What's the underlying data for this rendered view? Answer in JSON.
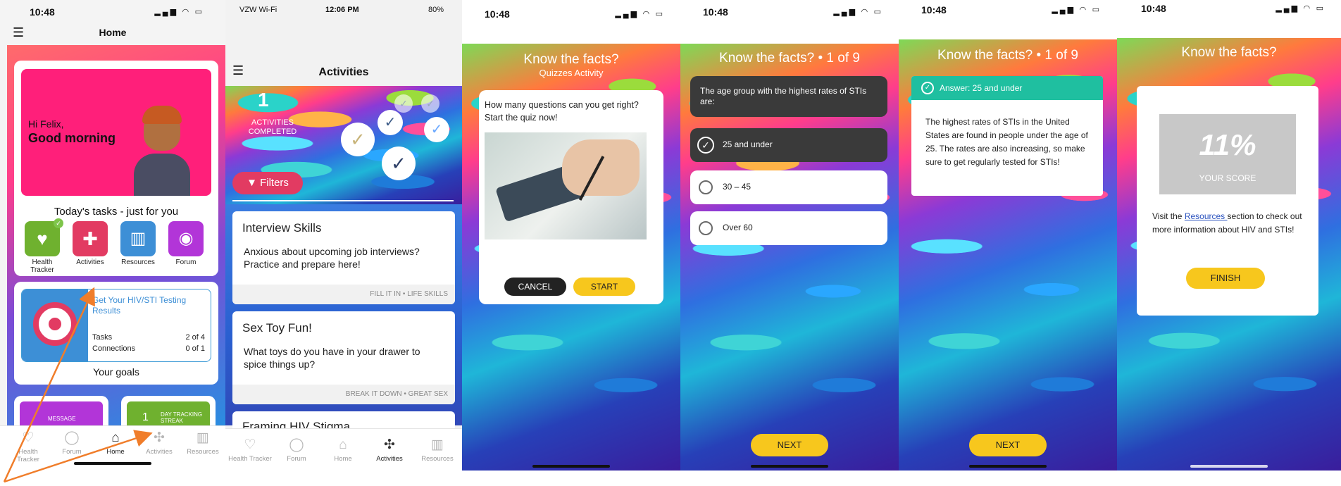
{
  "colors": {
    "accent_pink": "#ff1f7a",
    "accent_yellow": "#f7c71d",
    "accent_teal": "#1fbfa0",
    "link_blue": "#2a52be",
    "arrow_orange": "#f07d2a"
  },
  "screen1": {
    "time": "10:48",
    "title": "Home",
    "greeting_hi": "Hi Felix,",
    "greeting_main": "Good morning",
    "tasks_heading": "Today's tasks - just for you",
    "quick_actions": [
      {
        "label": "Health Tracker",
        "icon": "heart-pulse-icon",
        "color": "#6fb12f"
      },
      {
        "label": "Activities",
        "icon": "puzzle-icon",
        "color": "#e23b62"
      },
      {
        "label": "Resources",
        "icon": "books-icon",
        "color": "#3d8fd6"
      },
      {
        "label": "Forum",
        "icon": "chat-icon",
        "color": "#b235d8"
      }
    ],
    "goal": {
      "title": "Get Your HIV/STI Testing Results",
      "tasks_label": "Tasks",
      "tasks_value": "2 of 4",
      "connections_label": "Connections",
      "connections_value": "0 of 1"
    },
    "goals_heading": "Your goals",
    "tile_message": "MESSAGE",
    "tile_day_tracking": "DAY TRACKING STREAK",
    "tile_day_number": "1",
    "tabs": [
      "Health Tracker",
      "Forum",
      "Home",
      "Activities",
      "Resources"
    ]
  },
  "screen2": {
    "carrier": "VZW Wi-Fi",
    "time": "12:06 PM",
    "battery": "80%",
    "title": "Activities",
    "completed_count": "1",
    "completed_label": "ACTIVITIES COMPLETED",
    "filters_label": "Filters",
    "activities": [
      {
        "title": "Interview Skills",
        "desc": "Anxious about upcoming job interviews? Practice and prepare here!",
        "tag1": "FILL IT IN",
        "tag2": "LIFE SKILLS"
      },
      {
        "title": "Sex Toy Fun!",
        "desc": "What toys do you have in your drawer to spice things up?",
        "tag1": "BREAK IT DOWN",
        "tag2": "GREAT SEX"
      },
      {
        "title": "Framing HIV Stigma",
        "desc": "",
        "tag1": "",
        "tag2": ""
      }
    ],
    "tabs": [
      "Health Tracker",
      "Forum",
      "Home",
      "Activities",
      "Resources"
    ]
  },
  "screen3": {
    "time": "10:48",
    "title": "Know the facts?",
    "subtitle": "Quizzes Activity",
    "prompt": "How many questions can you get right? Start the quiz now!",
    "cancel_label": "CANCEL",
    "start_label": "START"
  },
  "screen4": {
    "time": "10:48",
    "title": "Know the facts? • 1 of 9",
    "question": "The age group with the highest rates of STIs are:",
    "options": [
      "25 and under",
      "30 – 45",
      "Over 60"
    ],
    "selected_index": 0,
    "next_label": "NEXT"
  },
  "screen5": {
    "time": "10:48",
    "title": "Know the facts? • 1 of 9",
    "answer": "Answer: 25 and under",
    "explanation": "The highest rates of STIs in the United States are found in people under the age of 25. The rates are also increasing, so make sure to get regularly tested for STIs!",
    "next_label": "NEXT"
  },
  "screen6": {
    "time": "10:48",
    "title": "Know the facts?",
    "score": "11%",
    "score_label": "YOUR SCORE",
    "text_before": "Visit the ",
    "link": "Resources ",
    "text_after": "section to check out more information about HIV and STIs!",
    "finish_label": "FINISH"
  }
}
